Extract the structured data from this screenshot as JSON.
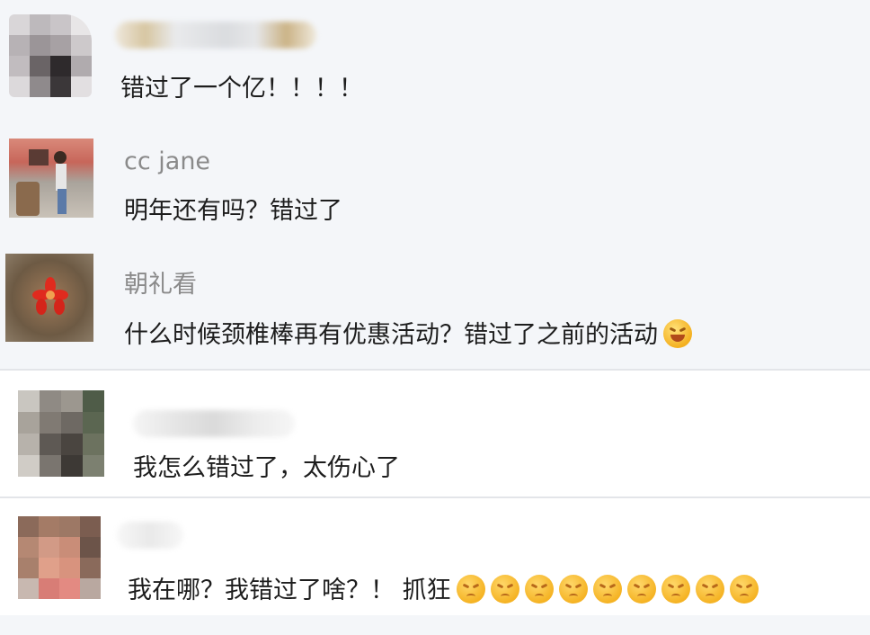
{
  "comments": [
    {
      "id": "c1",
      "name": "",
      "text": "错过了一个亿！！！！",
      "emojis": []
    },
    {
      "id": "c2",
      "name": "cc jane",
      "text": "明年还有吗？错过了",
      "emojis": []
    },
    {
      "id": "c3",
      "name": "朝礼看",
      "text": "什么时候颈椎棒再有优惠活动？错过了之前的活动",
      "emojis": [
        "laugh-emoji"
      ]
    },
    {
      "id": "c4",
      "name": "",
      "text": "我怎么错过了，太伤心了",
      "emojis": []
    },
    {
      "id": "c5",
      "name": "",
      "text": "我在哪？我错过了啥？！ 抓狂",
      "emojis": [
        "frown-emoji",
        "frown-emoji",
        "frown-emoji",
        "frown-emoji",
        "frown-emoji",
        "frown-emoji",
        "frown-emoji",
        "frown-emoji",
        "frown-emoji"
      ]
    }
  ],
  "colors": {
    "grey_panel": "#f4f6f9",
    "white_panel": "#ffffff",
    "name_text": "#8a8a8a",
    "comment_text": "#1d1d1d"
  }
}
